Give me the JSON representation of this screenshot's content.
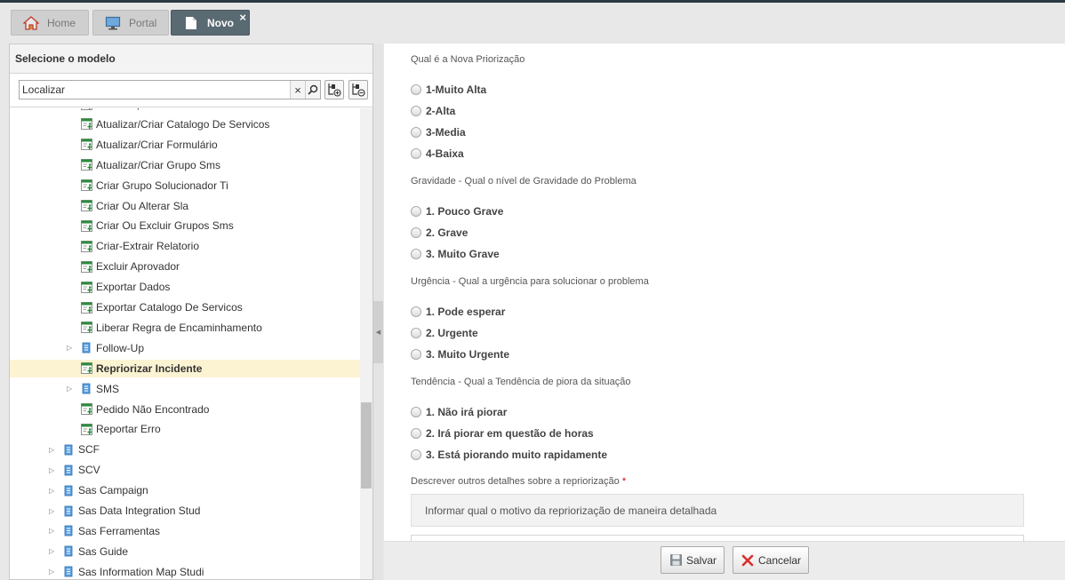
{
  "tabs": [
    {
      "label": "Home",
      "icon": "home-icon"
    },
    {
      "label": "Portal",
      "icon": "monitor-icon"
    },
    {
      "label": "Novo",
      "icon": "document-icon",
      "close": "×"
    }
  ],
  "left": {
    "title": "Selecione o modelo",
    "search": {
      "placeholder": "Localizar",
      "clear": "×"
    },
    "tree": [
      {
        "label": "Alterar Aprovador",
        "level": 2,
        "type": "form"
      },
      {
        "label": "Atualizar/Criar Catalogo De Servicos",
        "level": 2,
        "type": "form"
      },
      {
        "label": "Atualizar/Criar Formulário",
        "level": 2,
        "type": "form"
      },
      {
        "label": "Atualizar/Criar Grupo Sms",
        "level": 2,
        "type": "form"
      },
      {
        "label": "Criar Grupo Solucionador Ti",
        "level": 2,
        "type": "form"
      },
      {
        "label": "Criar Ou Alterar Sla",
        "level": 2,
        "type": "form"
      },
      {
        "label": "Criar Ou Excluir Grupos Sms",
        "level": 2,
        "type": "form"
      },
      {
        "label": "Criar-Extrair Relatorio",
        "level": 2,
        "type": "form"
      },
      {
        "label": "Excluir Aprovador",
        "level": 2,
        "type": "form"
      },
      {
        "label": "Exportar Dados",
        "level": 2,
        "type": "form"
      },
      {
        "label": "Exportar Catalogo De Servicos",
        "level": 2,
        "type": "form"
      },
      {
        "label": "Liberar Regra de Encaminhamento",
        "level": 2,
        "type": "form"
      },
      {
        "label": "Follow-Up",
        "level": 2,
        "type": "folder"
      },
      {
        "label": "Repriorizar Incidente",
        "level": 2,
        "type": "form",
        "selected": true
      },
      {
        "label": "SMS",
        "level": 2,
        "type": "folder"
      },
      {
        "label": "Pedido Não Encontrado",
        "level": 2,
        "type": "form"
      },
      {
        "label": "Reportar Erro",
        "level": 2,
        "type": "form"
      },
      {
        "label": "SCF",
        "level": 1,
        "type": "folder"
      },
      {
        "label": "SCV",
        "level": 1,
        "type": "folder"
      },
      {
        "label": "Sas Campaign",
        "level": 1,
        "type": "folder"
      },
      {
        "label": "Sas Data Integration Stud",
        "level": 1,
        "type": "folder"
      },
      {
        "label": "Sas Ferramentas",
        "level": 1,
        "type": "folder"
      },
      {
        "label": "Sas Guide",
        "level": 1,
        "type": "folder"
      },
      {
        "label": "Sas Information Map Studi",
        "level": 1,
        "type": "folder"
      }
    ]
  },
  "form": {
    "questions": [
      {
        "label": "Qual é a Nova Priorização",
        "options": [
          "1-Muito Alta",
          "2-Alta",
          "3-Media",
          "4-Baixa"
        ]
      },
      {
        "label": "Gravidade - Qual o nível de Gravidade do Problema",
        "options": [
          "1. Pouco Grave",
          "2. Grave",
          "3. Muito Grave"
        ]
      },
      {
        "label": "Urgência - Qual a urgência para solucionar o problema",
        "options": [
          "1. Pode esperar",
          "2. Urgente",
          "3. Muito Urgente"
        ]
      },
      {
        "label": "Tendência - Qual a Tendência de piora da situação",
        "options": [
          "1. Não irá piorar",
          "2. Irá piorar em questão de horas",
          "3. Está piorando muito rapidamente"
        ]
      }
    ],
    "details": {
      "label": "Descrever outros detalhes sobre a repriorização",
      "required": "*",
      "placeholder": "Informar qual o motivo da repriorização de maneira detalhada"
    }
  },
  "footer": {
    "save": "Salvar",
    "cancel": "Cancelar"
  },
  "colors": {
    "accent_tab": "#5a6a72",
    "selected_row": "#fcf3d3",
    "cancel_icon": "#d9302c"
  }
}
